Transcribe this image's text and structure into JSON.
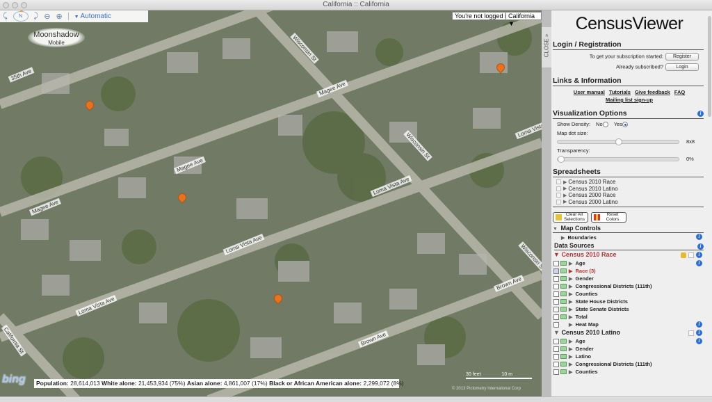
{
  "window": {
    "title": "California :: California"
  },
  "map": {
    "toolbar": {
      "rotate_left_icon": "rotate-left",
      "compass_label": "N",
      "rotate_right_icon": "rotate-right",
      "zoom_out_icon": "zoom-out",
      "zoom_in_icon": "zoom-in",
      "map_style": "Automatic"
    },
    "logo": {
      "line1": "Moonshadow",
      "line2": "Mobile"
    },
    "login_status": "You're not logged in",
    "region": "California",
    "streets": [
      "35th Ave",
      "Magee Ave",
      "Magee Ave",
      "Magee Ave",
      "Wisconsin St",
      "Wisconsin St",
      "Wisconsin St",
      "Loma Vista Ave",
      "Loma Vista Ave",
      "Loma Vista Ave",
      "Loma Vista Ave",
      "California St",
      "Brown Ave",
      "Brown Ave"
    ],
    "bing_label": "bing",
    "stats": {
      "population_label": "Population:",
      "population": "28,614,013",
      "white_label": "White alone:",
      "white": "21,453,934 (75%)",
      "asian_label": "Asian alone:",
      "asian": "4,861,007 (17%)",
      "black_label": "Black or African American alone:",
      "black": "2,299,072 (8%)"
    },
    "scale": {
      "feet": "30 feet",
      "meters": "10 m"
    },
    "copyright": "© 2013 Pictometry International Corp"
  },
  "close_tab": "CLOSE »",
  "panel": {
    "brand": "CensusViewer",
    "login": {
      "title": "Login / Registration",
      "register_prompt": "To get your subscription started:",
      "register_button": "Register",
      "login_prompt": "Already subscribed?",
      "login_button": "Login"
    },
    "links": {
      "title": "Links & Information",
      "items": [
        "User manual",
        "Tutorials",
        "Give feedback",
        "FAQ",
        "Mailing list sign-up"
      ]
    },
    "viz": {
      "title": "Visualization Options",
      "density_label": "Show Density:",
      "density_no": "No",
      "density_yes": "Yes",
      "density_selected": "Yes",
      "dot_size_label": "Map dot size:",
      "dot_size_value": "8x8",
      "dot_size_fraction": 0.5,
      "transparency_label": "Transparency:",
      "transparency_value": "0%",
      "transparency_fraction": 0
    },
    "spreadsheets": {
      "title": "Spreadsheets",
      "items": [
        "Census 2010 Race",
        "Census 2010 Latino",
        "Census 2000 Race",
        "Census 2000 Latino"
      ]
    },
    "actions": {
      "clear_all": "Clear All Selections",
      "reset_colors": "Reset Colors"
    },
    "map_controls": {
      "title": "Map Controls",
      "items": [
        "Boundaries"
      ]
    },
    "data_sources": {
      "title": "Data Sources",
      "groups": [
        {
          "title": "Census 2010 Race",
          "color": "#b33434",
          "items": [
            "Age",
            "Race (3)",
            "Gender",
            "Congressional Districts (111th)",
            "Counties",
            "State House Districts",
            "State Senate Districts",
            "Total",
            "Heat Map"
          ]
        },
        {
          "title": "Census 2010 Latino",
          "color": "#222222",
          "items": [
            "Age",
            "Gender",
            "Latino",
            "Congressional Districts (111th)",
            "Counties"
          ]
        }
      ]
    }
  }
}
